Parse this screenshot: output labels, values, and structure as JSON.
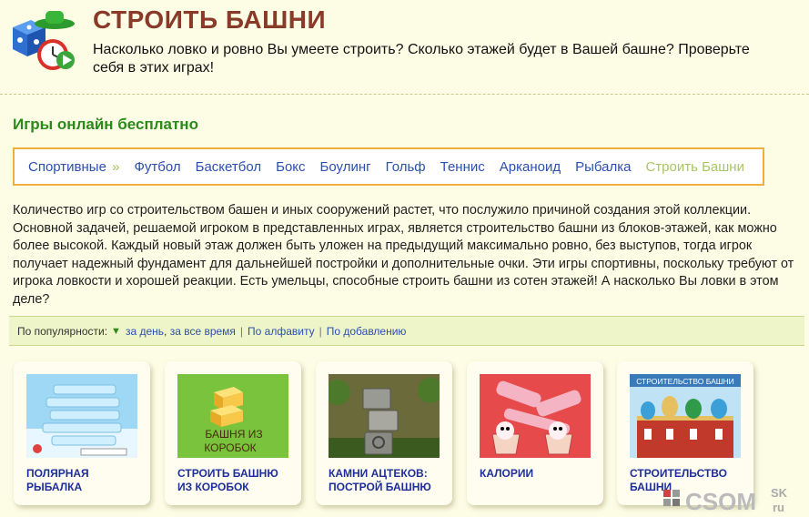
{
  "header": {
    "title": "СТРОИТЬ БАШНИ",
    "subtitle": "Насколько ловко и ровно Вы умеете строить? Сколько этажей будет в Вашей башне? Проверьте себя в этих играх!"
  },
  "section_heading": "Игры онлайн бесплатно",
  "nav": {
    "items": [
      {
        "label": "Спортивные",
        "suffix": "»"
      },
      {
        "label": "Футбол"
      },
      {
        "label": "Баскетбол"
      },
      {
        "label": "Бокс"
      },
      {
        "label": "Боулинг"
      },
      {
        "label": "Гольф"
      },
      {
        "label": "Теннис"
      },
      {
        "label": "Арканоид"
      },
      {
        "label": "Рыбалка"
      },
      {
        "label": "Строить Башни"
      }
    ]
  },
  "description": "Количество игр со строительством башен и иных сооружений растет, что послужило причиной создания этой коллекции. Основной задачей, решаемой игроком в представленных играх, является строительство башни из блоков-этажей, как можно более высокой. Каждый новый этаж должен быть уложен на предыдущий максимально ровно, без выступов, тогда игрок получает надежный фундамент для дальнейшей постройки и дополнительные очки. Эти игры спортивны, поскольку требуют от игрока ловкости и хорошей реакции. Есть умельцы, способные строить башни из сотен этажей! А насколько Вы ловки в этом деле?",
  "sortbar": {
    "label": "По популярности:",
    "by_day": "за день",
    "by_all_time": "за все время",
    "alphabetical": "По алфавиту",
    "by_added": "По добавлению"
  },
  "games": [
    {
      "title": "ПОЛЯРНАЯ РЫБАЛКА"
    },
    {
      "title": "СТРОИТЬ БАШНЮ ИЗ КОРОБОК",
      "thumb_text": "БАШНЯ ИЗ КОРОБОК"
    },
    {
      "title": "КАМНИ АЦТЕКОВ: ПОСТРОЙ БАШНЮ"
    },
    {
      "title": "КАЛОРИИ"
    },
    {
      "title": "СТРОИТЕЛЬСТВО БАШНИ",
      "thumb_text": "СТРОИТЕЛЬСТВО БАШНИ"
    }
  ],
  "watermark": {
    "main": "CSOM",
    "top": "SK",
    "bottom": "ru"
  },
  "colors": {
    "title": "#8a3a28",
    "heading": "#2a8a1a",
    "link": "#2d4fb0",
    "current_nav": "#a9c464",
    "nav_border": "#f0b040",
    "background": "#fdfde6",
    "game_title": "#1d2f9a"
  },
  "icons": {
    "logo": "dice-clock-logo-icon",
    "sort_arrow": "triangle-down-icon"
  }
}
